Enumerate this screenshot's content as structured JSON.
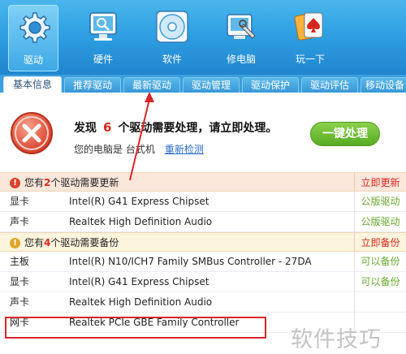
{
  "nav": [
    {
      "label": "驱动",
      "icon": "gear-icon",
      "active": true
    },
    {
      "label": "硬件",
      "icon": "monitor-icon",
      "active": false
    },
    {
      "label": "软件",
      "icon": "disc-icon",
      "active": false
    },
    {
      "label": "修电脑",
      "icon": "repair-icon",
      "active": false
    },
    {
      "label": "玩一下",
      "icon": "cards-icon",
      "active": false
    }
  ],
  "tabs": [
    "基本信息",
    "推荐驱动",
    "最新驱动",
    "驱动管理",
    "驱动保护",
    "驱动评估",
    "移动设备"
  ],
  "alert": {
    "title_prefix": "发现",
    "count": "6",
    "title_suffix": "个驱动需要处理，请立即处理。",
    "sub_prefix": "您的电脑是 台式机",
    "sub_link": "重新检测",
    "fix_button": "一键处理"
  },
  "update_section": {
    "prefix": "您有",
    "count": "2",
    "suffix": "个驱动需要更新",
    "action": "立即更新",
    "rows": [
      {
        "cat": "显卡",
        "dev": "Intel(R) G41 Express Chipset",
        "act": "公版驱动"
      },
      {
        "cat": "声卡",
        "dev": "Realtek High Definition Audio",
        "act": "公版驱动"
      }
    ]
  },
  "backup_section": {
    "prefix": "您有",
    "count": "4",
    "suffix": "个驱动需要备份",
    "action": "立即备份",
    "rows": [
      {
        "cat": "主板",
        "dev": "Intel(R) N10/ICH7 Family SMBus Controller - 27DA",
        "act": "可以备份"
      },
      {
        "cat": "显卡",
        "dev": "Intel(R) G41 Express Chipset",
        "act": "可以备份"
      },
      {
        "cat": "声卡",
        "dev": "Realtek High Definition Audio",
        "act": ""
      },
      {
        "cat": "网卡",
        "dev": "Realtek PCIe GBE Family Controller",
        "act": ""
      }
    ]
  },
  "watermark": "软件技巧",
  "colors": {
    "toolbar": "#2fa0e2",
    "accent_red": "#d8281c",
    "green": "#66a82e",
    "annotation": "#d9252a"
  }
}
